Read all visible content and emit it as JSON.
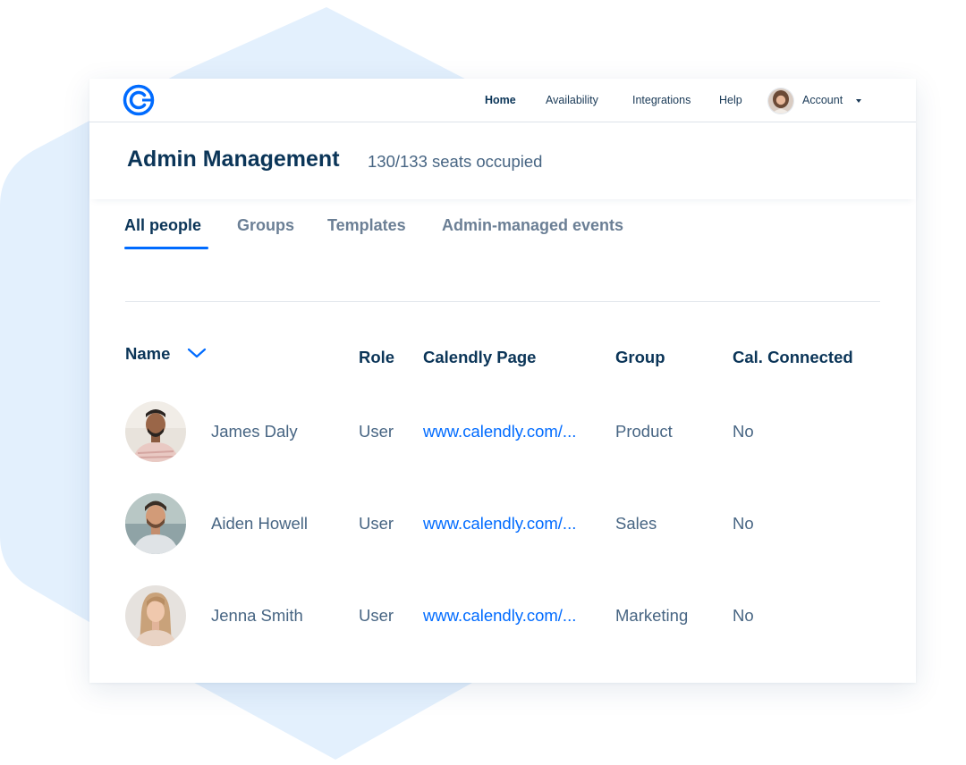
{
  "nav": {
    "items": [
      "Home",
      "Availability",
      "Integrations",
      "Help"
    ],
    "account_label": "Account"
  },
  "header": {
    "title": "Admin Management",
    "seats": "130/133 seats occupied"
  },
  "tabs": [
    "All people",
    "Groups",
    "Templates",
    "Admin-managed events"
  ],
  "active_tab": "All people",
  "table": {
    "columns": [
      "Name",
      "Role",
      "Calendly Page",
      "Group",
      "Cal. Connected"
    ],
    "sorted_by": "Name",
    "rows": [
      {
        "name": "James Daly",
        "role": "User",
        "page": "www.calendly.com/...",
        "group": "Product",
        "connected": "No"
      },
      {
        "name": "Aiden Howell",
        "role": "User",
        "page": "www.calendly.com/...",
        "group": "Sales",
        "connected": "No"
      },
      {
        "name": "Jenna Smith",
        "role": "User",
        "page": "www.calendly.com/...",
        "group": "Marketing",
        "connected": "No"
      }
    ]
  },
  "colors": {
    "brand_blue": "#006bff",
    "navy": "#0b3558",
    "muted_text": "#476583",
    "hex_background": "#e3f0fd"
  },
  "icons": {
    "logo": "calendly-logo-icon",
    "sort": "chevron-down-icon",
    "account_menu": "caret-down-icon"
  }
}
